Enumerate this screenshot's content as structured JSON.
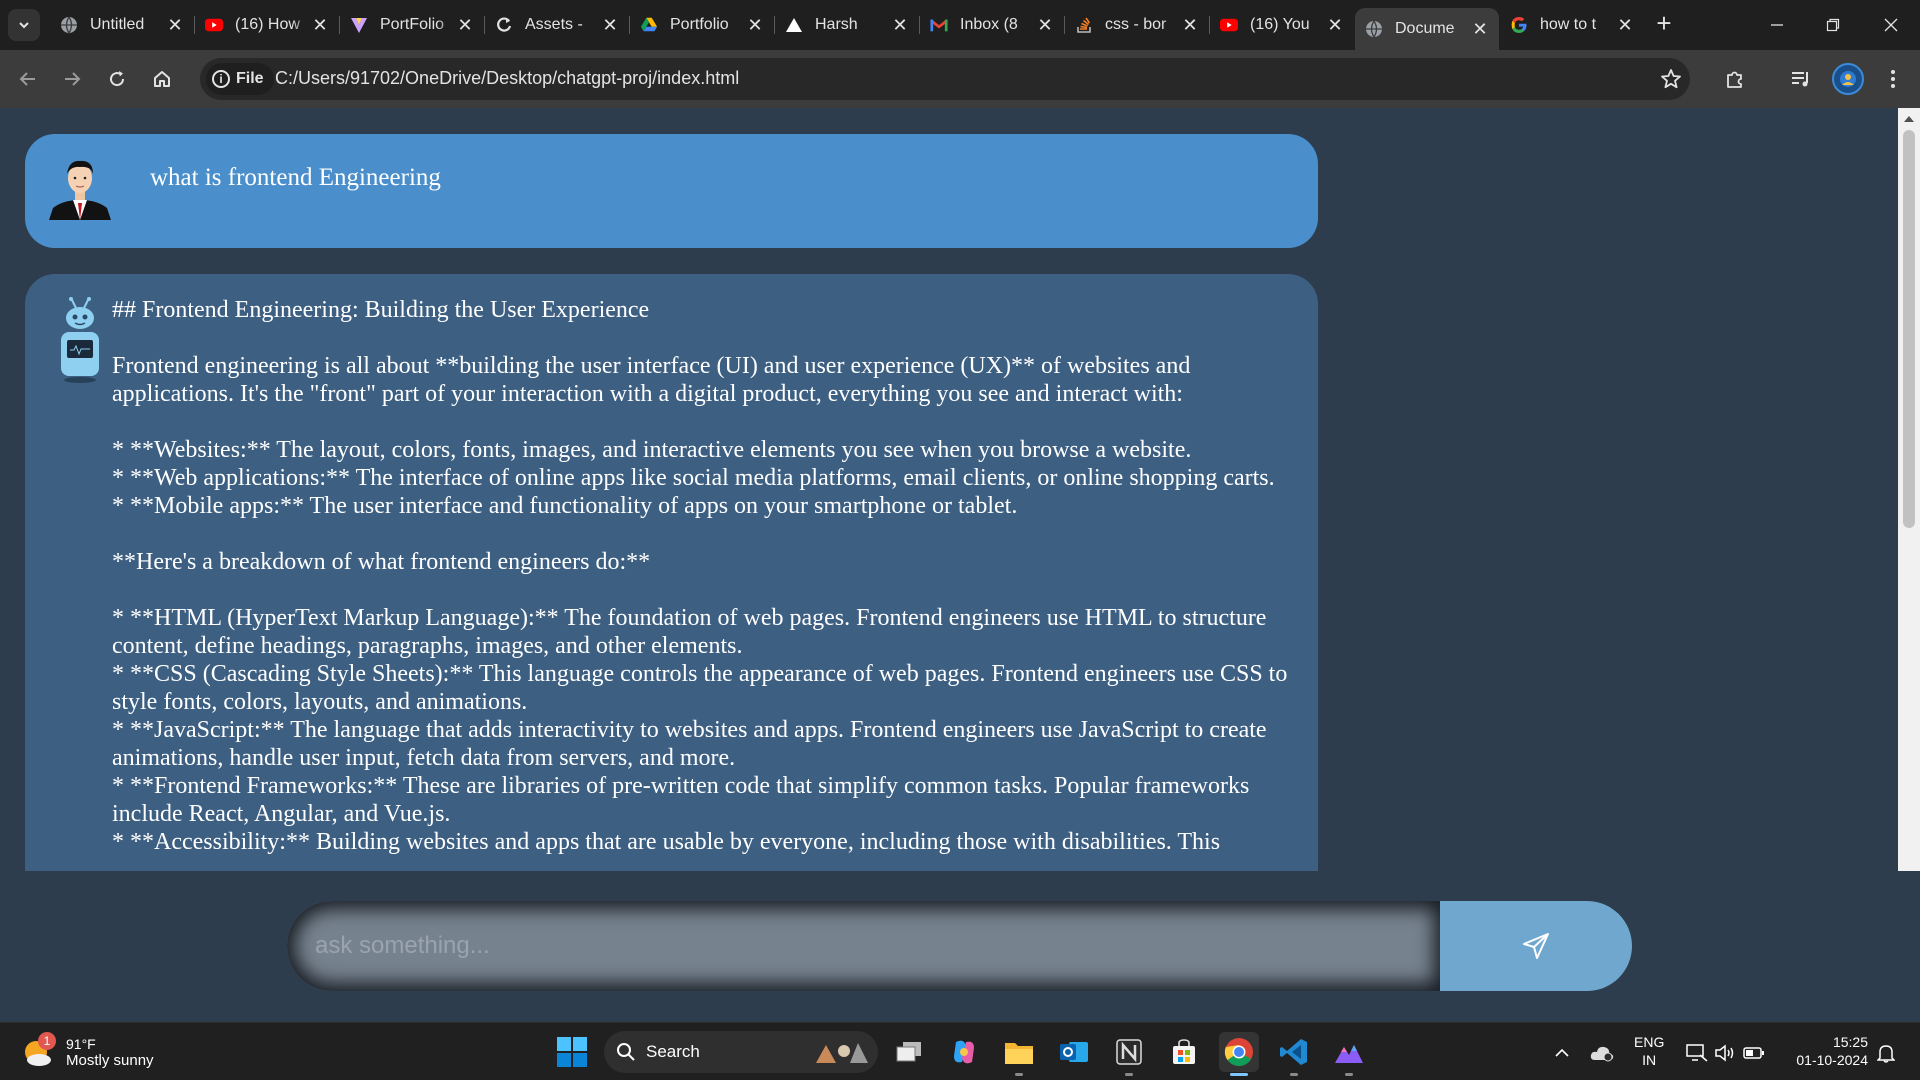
{
  "browser": {
    "tabs": [
      {
        "title": "Untitled",
        "favicon": "globe-icon"
      },
      {
        "title": "(16) How",
        "favicon": "youtube-icon"
      },
      {
        "title": "PortFolio",
        "favicon": "vercel-v-icon"
      },
      {
        "title": "Assets -",
        "favicon": "refresh-g-icon"
      },
      {
        "title": "Portfolio",
        "favicon": "google-drive-icon"
      },
      {
        "title": "Harsh",
        "favicon": "triangle-icon"
      },
      {
        "title": "Inbox (8",
        "favicon": "gmail-icon"
      },
      {
        "title": "css - bor",
        "favicon": "stackoverflow-icon"
      },
      {
        "title": "(16) You",
        "favicon": "youtube-icon"
      },
      {
        "title": "Docume",
        "favicon": "globe-icon",
        "active": true
      },
      {
        "title": "how to t",
        "favicon": "google-icon"
      }
    ],
    "file_chip": "File",
    "url": "C:/Users/91702/OneDrive/Desktop/chatgpt-proj/index.html"
  },
  "chat": {
    "user_message": "what is frontend Engineering",
    "bot_message": "## Frontend Engineering: Building the User Experience\n\nFrontend engineering is all about **building the user interface (UI) and user experience (UX)** of websites and applications. It's the \"front\" part of your interaction with a digital product, everything you see and interact with:\n\n* **Websites:** The layout, colors, fonts, images, and interactive elements you see when you browse a website.\n* **Web applications:** The interface of online apps like social media platforms, email clients, or online shopping carts.\n* **Mobile apps:** The user interface and functionality of apps on your smartphone or tablet.\n\n**Here's a breakdown of what frontend engineers do:**\n\n* **HTML (HyperText Markup Language):** The foundation of web pages. Frontend engineers use HTML to structure content, define headings, paragraphs, images, and other elements.\n* **CSS (Cascading Style Sheets):** This language controls the appearance of web pages. Frontend engineers use CSS to style fonts, colors, layouts, and animations.\n* **JavaScript:** The language that adds interactivity to websites and apps. Frontend engineers use JavaScript to create animations, handle user input, fetch data from servers, and more.\n* **Frontend Frameworks:** These are libraries of pre-written code that simplify common tasks. Popular frameworks include React, Angular, and Vue.js.\n* **Accessibility:** Building websites and apps that are usable by everyone, including those with disabilities. This",
    "input_placeholder": "ask something..."
  },
  "taskbar": {
    "weather_temp": "91°F",
    "weather_desc": "Mostly sunny",
    "weather_badge": "1",
    "search_label": "Search",
    "lang_line1": "ENG",
    "lang_line2": "IN",
    "time": "15:25",
    "date": "01-10-2024"
  },
  "colors": {
    "user_bubble": "#4a8fcc",
    "bot_bubble": "#3d5f82",
    "page_bg": "#2e3d4d",
    "send_button": "#6fa7cf"
  }
}
